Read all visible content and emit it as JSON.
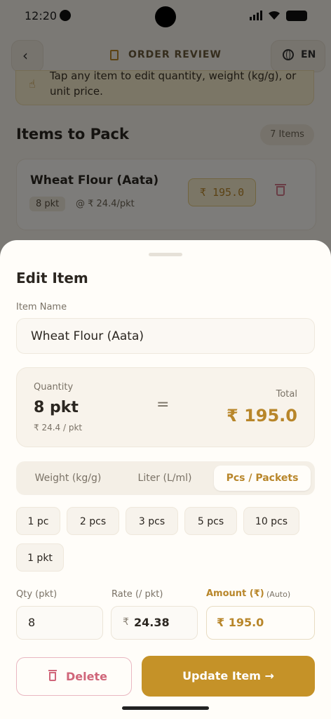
{
  "status": {
    "time": "12:20"
  },
  "header": {
    "title": "ORDER REVIEW",
    "language": "EN"
  },
  "tip": {
    "text": "Tap any item to edit quantity, weight (kg/g), or unit price."
  },
  "section": {
    "title": "Items to Pack",
    "count": "7 Items"
  },
  "item_card": {
    "name": "Wheat Flour (Aata)",
    "qty": "8 pkt",
    "rate": "@ ₹ 24.4/pkt",
    "amount": "₹ 195.0"
  },
  "sheet": {
    "title": "Edit Item",
    "item_name_label": "Item Name",
    "item_name_value": "Wheat Flour (Aata)",
    "summary": {
      "qty_label": "Quantity",
      "qty_value": "8 pkt",
      "rate_text": "₹ 24.4 / pkt",
      "equals": "=",
      "total_label": "Total",
      "total_value": "₹ 195.0"
    },
    "units": [
      "Weight (kg/g)",
      "Liter (L/ml)",
      "Pcs / Packets"
    ],
    "active_unit": "Pcs / Packets",
    "chips": [
      "1 pc",
      "2 pcs",
      "3 pcs",
      "5 pcs",
      "10 pcs",
      "1 pkt"
    ],
    "qty_label": "Qty (pkt)",
    "qty_value": "8",
    "rate_label": "Rate (/ pkt)",
    "rate_prefix": "₹",
    "rate_value": "24.38",
    "amount_label": "Amount (₹)",
    "amount_auto": "(Auto)",
    "amount_value": "₹ 195.0",
    "delete_label": "Delete",
    "update_label": "Update Item →"
  },
  "colors": {
    "accent": "#c59228",
    "danger": "#d0667a",
    "background": "#fffdf9"
  }
}
